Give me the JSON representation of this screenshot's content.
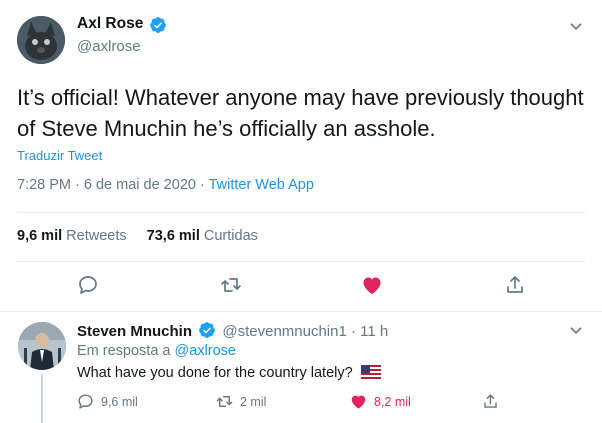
{
  "tweet": {
    "author_name": "Axl Rose",
    "author_handle": "@axlrose",
    "text": "It’s official! Whatever anyone may have previously thought of Steve Mnuchin he’s officially an asshole.",
    "translate_label": "Traduzir Tweet",
    "timestamp": "7:28 PM · 6 de mai de 2020 · ",
    "source_app": "Twitter Web App",
    "retweets_count": "9,6 mil",
    "retweets_label": "Retweets",
    "likes_count": "73,6 mil",
    "likes_label": "Curtidas",
    "liked": true,
    "icons": [
      "chevron-down-icon",
      "reply-icon",
      "retweet-icon",
      "heart-icon",
      "share-icon",
      "verified-icon"
    ]
  },
  "reply": {
    "author_name": "Steven Mnuchin",
    "author_handle": "@stevenmnuchin1",
    "time_ago": "· 11 h",
    "reply_prefix": "Em resposta a",
    "reply_mention": "@axlrose",
    "text": "What have you done for the country lately?",
    "emoji": "us-flag",
    "reply_count": "9,6 mil",
    "retweet_count": "2 mil",
    "like_count": "8,2 mil"
  },
  "colors": {
    "accent": "#1b95e0",
    "like": "#e0245e",
    "muted": "#657786",
    "text": "#14171a",
    "divider": "#e6ecf0"
  }
}
